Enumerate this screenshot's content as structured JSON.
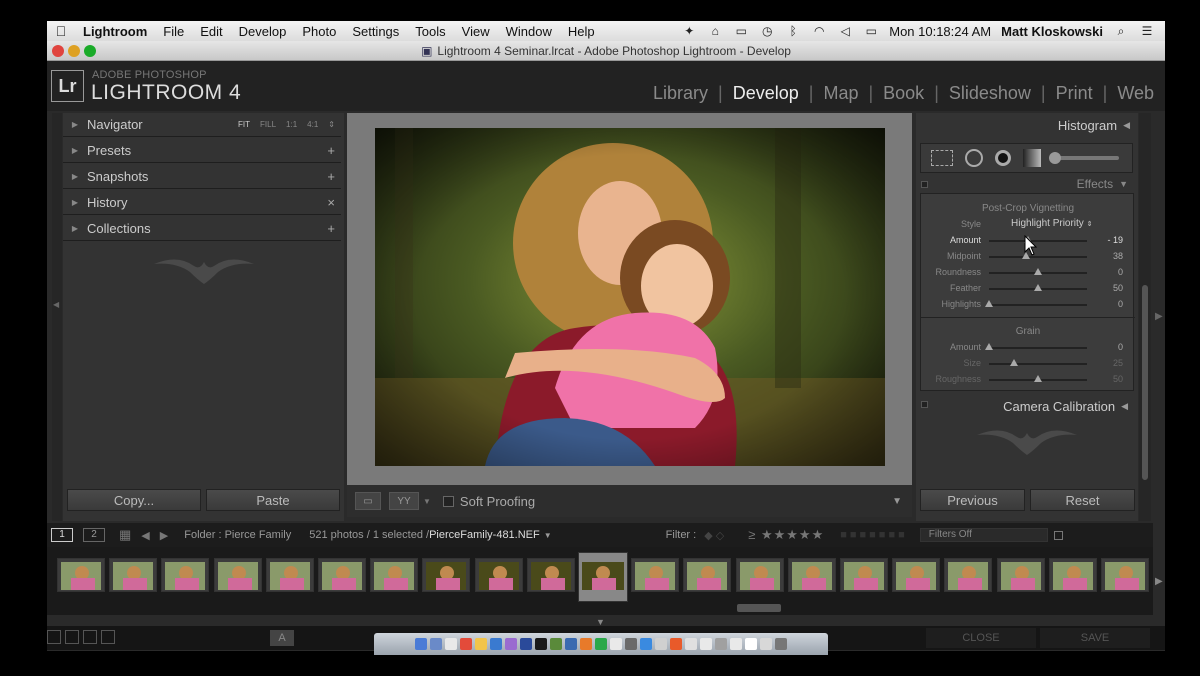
{
  "menubar": {
    "items": [
      "Lightroom",
      "File",
      "Edit",
      "Develop",
      "Photo",
      "Settings",
      "Tools",
      "View",
      "Window",
      "Help"
    ],
    "clock": "Mon 10:18:24 AM",
    "user": "Matt Kloskowski"
  },
  "window": {
    "title": "Lightroom 4 Seminar.lrcat - Adobe Photoshop Lightroom - Develop"
  },
  "identity": {
    "logo": "Lr",
    "line1": "ADOBE PHOTOSHOP",
    "line2": "LIGHTROOM 4"
  },
  "modules": [
    "Library",
    "Develop",
    "Map",
    "Book",
    "Slideshow",
    "Print",
    "Web"
  ],
  "left_panel": {
    "navigator": {
      "label": "Navigator",
      "zoom": [
        "FIT",
        "FILL",
        "1:1",
        "4:1"
      ]
    },
    "panels": [
      {
        "label": "Presets",
        "ctrl": "+"
      },
      {
        "label": "Snapshots",
        "ctrl": "+"
      },
      {
        "label": "History",
        "ctrl": "×"
      },
      {
        "label": "Collections",
        "ctrl": "+"
      }
    ],
    "copy": "Copy...",
    "paste": "Paste"
  },
  "toolbar": {
    "view_mode": "YY",
    "soft_proofing": "Soft Proofing"
  },
  "right_panel": {
    "histogram": "Histogram",
    "effects": "Effects",
    "vignette": {
      "title": "Post-Crop Vignetting",
      "style_label": "Style",
      "style_value": "Highlight Priority",
      "sliders": [
        {
          "label": "Amount",
          "value": "- 19",
          "pos": 0.4
        },
        {
          "label": "Midpoint",
          "value": "38",
          "pos": 0.38
        },
        {
          "label": "Roundness",
          "value": "0",
          "pos": 0.5
        },
        {
          "label": "Feather",
          "value": "50",
          "pos": 0.5
        },
        {
          "label": "Highlights",
          "value": "0",
          "pos": 0.0
        }
      ]
    },
    "grain": {
      "title": "Grain",
      "sliders": [
        {
          "label": "Amount",
          "value": "0",
          "pos": 0.0
        },
        {
          "label": "Size",
          "value": "25",
          "pos": 0.25
        },
        {
          "label": "Roughness",
          "value": "50",
          "pos": 0.5
        }
      ]
    },
    "calibration": "Camera Calibration",
    "previous": "Previous",
    "reset": "Reset"
  },
  "filmstrip_bar": {
    "page1": "1",
    "page2": "2",
    "folder": "Folder : Pierce Family",
    "count": "521 photos / 1 selected /",
    "filename": "PierceFamily-481.NEF",
    "filter_label": "Filter :",
    "stars": "≥ ★★★★★",
    "filters_off": "Filters Off",
    "thumbnail_count": 21,
    "selected_index": 10
  },
  "bottom": {
    "a_btn": "A",
    "close": "CLOSE",
    "save": "SAVE"
  }
}
